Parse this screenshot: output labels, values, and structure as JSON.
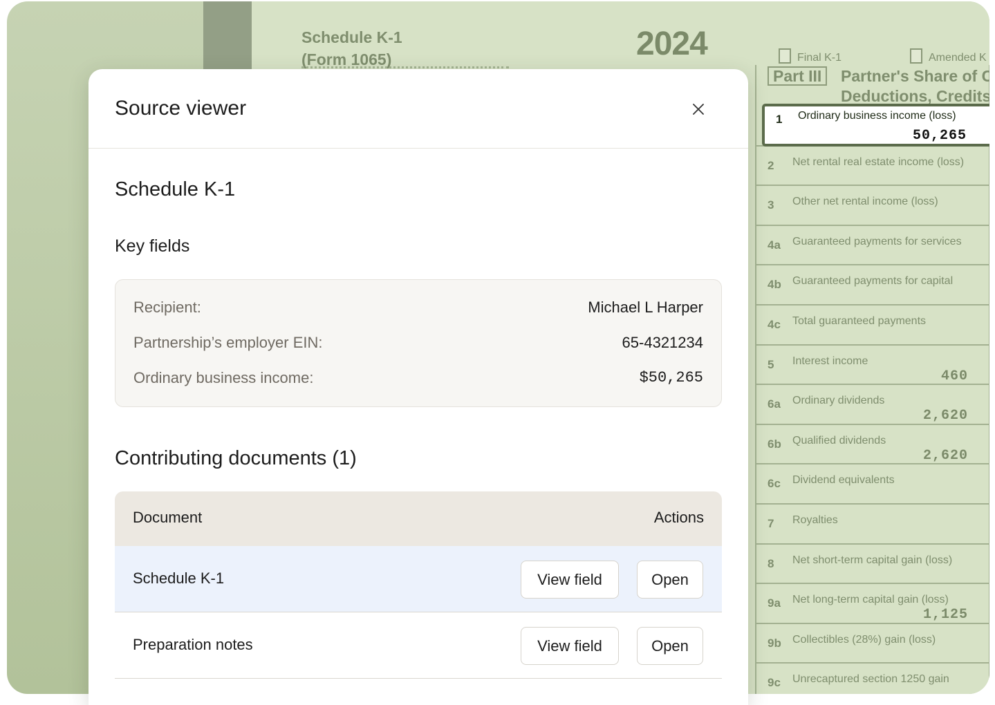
{
  "background_form": {
    "title_line1": "Schedule K-1",
    "title_line2": "(Form 1065)",
    "year": "2024",
    "checkbox_final": "Final K-1",
    "checkbox_amended": "Amended K",
    "part_badge": "Part III",
    "part_title_line1": "Partner's Share of C",
    "part_title_line2": "Deductions, Credits",
    "rows": [
      {
        "num": "1",
        "label": "Ordinary business income (loss)",
        "value": "50,265",
        "highlighted": true
      },
      {
        "num": "2",
        "label": "Net rental real estate income (loss)",
        "value": ""
      },
      {
        "num": "3",
        "label": "Other net rental income (loss)",
        "value": ""
      },
      {
        "num": "4a",
        "label": "Guaranteed payments for services",
        "value": ""
      },
      {
        "num": "4b",
        "label": "Guaranteed payments for capital",
        "value": ""
      },
      {
        "num": "4c",
        "label": "Total guaranteed payments",
        "value": ""
      },
      {
        "num": "5",
        "label": "Interest income",
        "value": "460"
      },
      {
        "num": "6a",
        "label": "Ordinary dividends",
        "value": "2,620"
      },
      {
        "num": "6b",
        "label": "Qualified dividends",
        "value": "2,620"
      },
      {
        "num": "6c",
        "label": "Dividend equivalents",
        "value": ""
      },
      {
        "num": "7",
        "label": "Royalties",
        "value": ""
      },
      {
        "num": "8",
        "label": "Net short-term capital gain (loss)",
        "value": ""
      },
      {
        "num": "9a",
        "label": "Net long-term capital gain (loss)",
        "value": "1,125"
      },
      {
        "num": "9b",
        "label": "Collectibles (28%) gain (loss)",
        "value": ""
      },
      {
        "num": "9c",
        "label": "Unrecaptured section 1250 gain",
        "value": ""
      }
    ]
  },
  "modal": {
    "title": "Source viewer",
    "close_icon": "close-icon",
    "form_name": "Schedule K-1",
    "key_fields_heading": "Key fields",
    "key_fields": [
      {
        "label": "Recipient:",
        "value": "Michael L Harper"
      },
      {
        "label": "Partnership’s employer EIN:",
        "value": "65-4321234"
      },
      {
        "label": "Ordinary business income:",
        "value": "$50,265"
      }
    ],
    "contributing_heading": "Contributing documents (1)",
    "table": {
      "col_document": "Document",
      "col_actions": "Actions",
      "rows": [
        {
          "name": "Schedule K-1",
          "view_label": "View field",
          "open_label": "Open",
          "active": true
        },
        {
          "name": "Preparation notes",
          "view_label": "View field",
          "open_label": "Open",
          "active": false
        }
      ]
    }
  },
  "colors": {
    "backdrop": "#b8c6a2",
    "form_paper": "#d7e2c6",
    "highlight_border": "#5b6b4b",
    "active_row": "#ecf2fc",
    "table_header": "#ece8e1"
  }
}
